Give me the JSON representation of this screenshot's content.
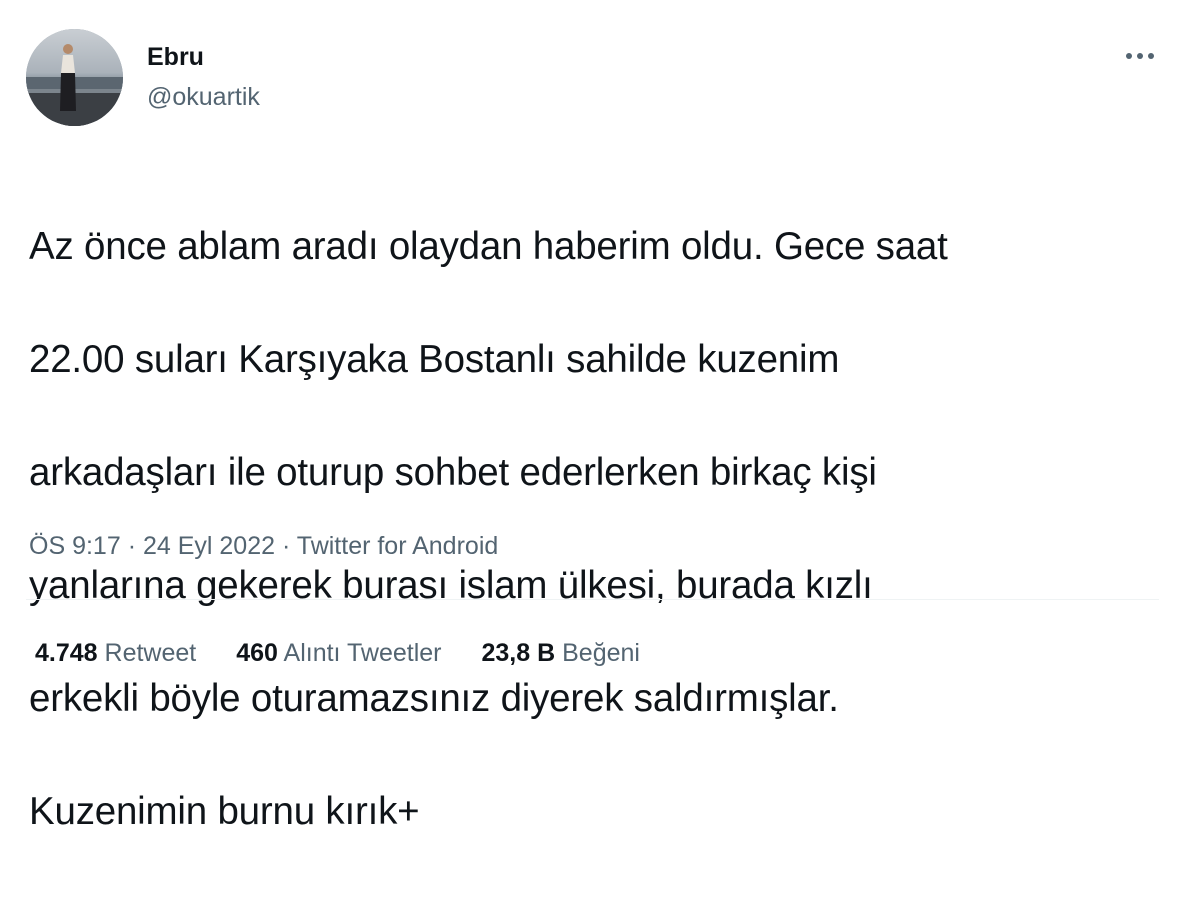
{
  "author": {
    "display_name": "Ebru",
    "handle": "@okuartik",
    "avatar_icon": "profile-photo"
  },
  "more_icon": "more-dots-icon",
  "tweet": {
    "lines": [
      "Az önce ablam aradı olaydan haberim oldu. Gece saat",
      "22.00 suları Karşıyaka Bostanlı sahilde kuzenim",
      "arkadaşları ile oturup sohbet ederlerken birkaç kişi",
      "yanlarına gekerek burası islam ülkesi, burada kızlı",
      "erkekli böyle oturamazsınız diyerek saldırmışlar.",
      "Kuzenimin burnu kırık+"
    ]
  },
  "meta": {
    "time": "ÖS 9:17",
    "separator": "·",
    "date": "24 Eyl 2022",
    "source": "Twitter for Android"
  },
  "stats": {
    "retweets_count": "4.748",
    "retweets_label": "Retweet",
    "quotes_count": "460",
    "quotes_label": "Alıntı Tweetler",
    "likes_count": "23,8 B",
    "likes_label": "Beğeni"
  },
  "colors": {
    "text_primary": "#0f1419",
    "text_secondary": "#536471",
    "divider": "#eff3f4"
  }
}
